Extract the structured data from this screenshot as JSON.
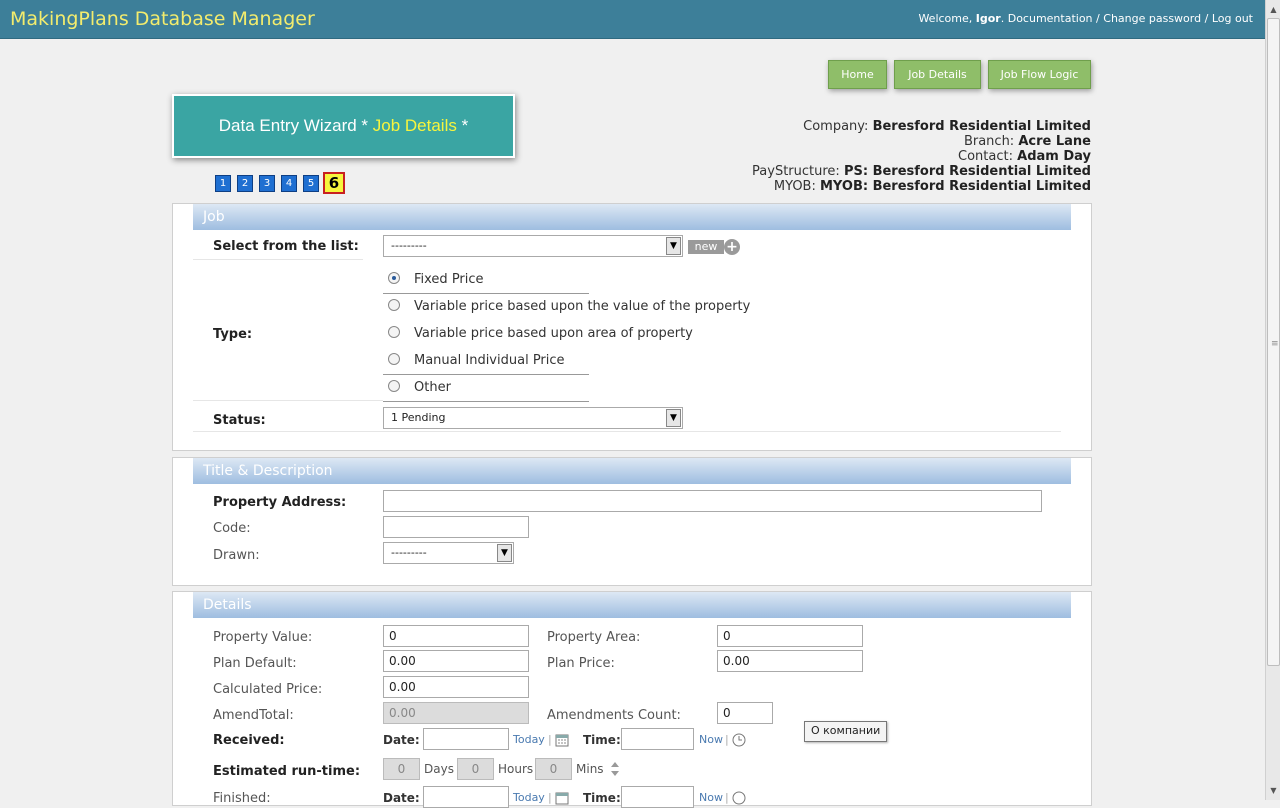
{
  "header": {
    "app_title": "MakingPlans Database Manager",
    "welcome_prefix": "Welcome,",
    "user": "Igor",
    "documentation": "Documentation",
    "change_password": "Change password",
    "log_out": "Log out",
    "separator": "/"
  },
  "nav": {
    "home": "Home",
    "job_details": "Job Details",
    "job_flow_logic": "Job Flow Logic"
  },
  "wizard": {
    "title_prefix": "Data Entry Wizard *",
    "title_highlight": "Job Details",
    "title_suffix": "*",
    "steps": [
      "1",
      "2",
      "3",
      "4",
      "5",
      "6"
    ],
    "current_step": "6"
  },
  "company_info": {
    "company_label": "Company:",
    "company_value": "Beresford Residential Limited",
    "branch_label": "Branch:",
    "branch_value": "Acre Lane",
    "contact_label": "Contact:",
    "contact_value": "Adam Day",
    "paystructure_label": "PayStructure:",
    "paystructure_value": "PS: Beresford Residential Limited",
    "myob_label": "MYOB:",
    "myob_value": "MYOB: Beresford Residential Limited"
  },
  "job_section": {
    "title": "Job",
    "select_label": "Select from the list:",
    "select_value": "---------",
    "new_label": "new",
    "plus": "+",
    "type_label": "Type:",
    "types": [
      "Fixed Price",
      "Variable price based upon the value of the property",
      "Variable price based upon area of property",
      "Manual Individual Price",
      "Other"
    ],
    "selected_type": "Fixed Price",
    "status_label": "Status:",
    "status_value": "1 Pending"
  },
  "title_section": {
    "title": "Title & Description",
    "address_label": "Property Address:",
    "address_value": "",
    "code_label": "Code:",
    "code_value": "",
    "drawn_label": "Drawn:",
    "drawn_value": "---------"
  },
  "details_section": {
    "title": "Details",
    "property_value_label": "Property Value:",
    "property_value": "0",
    "property_area_label": "Property Area:",
    "property_area": "0",
    "plan_default_label": "Plan Default:",
    "plan_default": "0.00",
    "plan_price_label": "Plan Price:",
    "plan_price": "0.00",
    "calculated_price_label": "Calculated Price:",
    "calculated_price": "0.00",
    "amend_total_label": "AmendTotal:",
    "amend_total": "0.00",
    "amendments_count_label": "Amendments Count:",
    "amendments_count": "0",
    "received_label": "Received:",
    "date_label": "Date:",
    "today_link": "Today",
    "time_label": "Time:",
    "now_link": "Now",
    "bar": "|",
    "runtime_label": "Estimated run-time:",
    "runtime_days": "0",
    "days_label": "Days",
    "runtime_hours": "0",
    "hours_label": "Hours",
    "runtime_mins": "0",
    "mins_label": "Mins",
    "finished_label": "Finished:"
  },
  "tooltip": "О компании",
  "colors": {
    "header_bg": "#3d7f99",
    "title_yellow": "#f3ec6d",
    "nav_green": "#8fbe69",
    "wizard_teal": "#3aa5a3",
    "step_blue": "#1f6fd1",
    "section_blue": "#9ebde0"
  }
}
